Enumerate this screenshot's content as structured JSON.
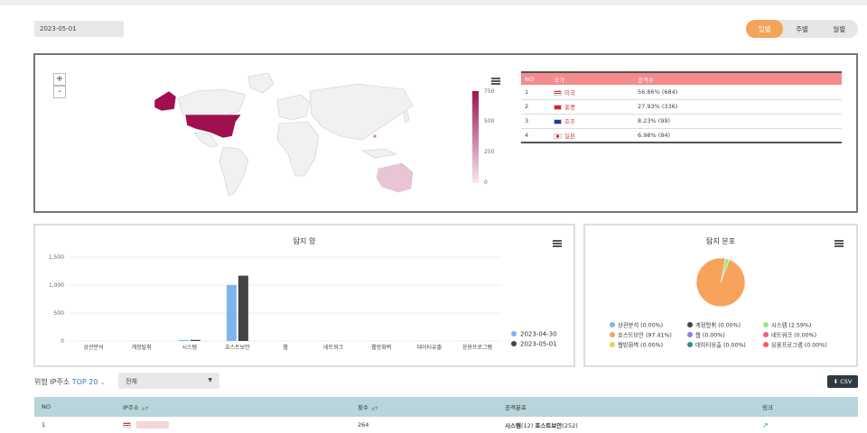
{
  "date": "2023-05-01",
  "period": {
    "tabs": [
      "일별",
      "주별",
      "월별"
    ],
    "active": "일별"
  },
  "map": {
    "zoom_in": "+",
    "zoom_out": "-",
    "scale_ticks": [
      "750",
      "500",
      "250",
      "0"
    ],
    "colors": {
      "max": "#a0104f",
      "min": "#f7e9f1"
    }
  },
  "geo_table": {
    "headers": [
      "NO",
      "국가",
      "공격수"
    ],
    "rows": [
      {
        "no": "1",
        "flag": "us-flag",
        "country": "미국",
        "attacks": "56.86% (684)"
      },
      {
        "no": "2",
        "flag": "hk-flag",
        "country": "홍콩",
        "attacks": "27.93% (336)"
      },
      {
        "no": "3",
        "flag": "au-flag",
        "country": "호주",
        "attacks": "8.23% (99)"
      },
      {
        "no": "4",
        "flag": "jp-flag",
        "country": "일본",
        "attacks": "6.98% (84)"
      }
    ]
  },
  "bar_panel": {
    "title": "탐지 양"
  },
  "pie_panel": {
    "title": "탐지 분포"
  },
  "chart_data": [
    {
      "type": "bar",
      "title": "탐지 양",
      "categories": [
        "상관분석",
        "계정탈취",
        "시스템",
        "호스트보안",
        "웹",
        "네트워크",
        "웹방화벽",
        "데이터유출",
        "응용프로그램"
      ],
      "series": [
        {
          "name": "2023-04-30",
          "color": "#7cb5ec",
          "values": [
            0,
            0,
            12,
            1000,
            0,
            0,
            0,
            0,
            0
          ]
        },
        {
          "name": "2023-05-01",
          "color": "#434348",
          "values": [
            0,
            0,
            12,
            1168,
            0,
            0,
            0,
            0,
            0
          ]
        }
      ],
      "yticks": [
        "0",
        "500",
        "1,000",
        "1,500"
      ],
      "ylim": [
        0,
        1500
      ],
      "grid": true,
      "legend": "right"
    },
    {
      "type": "pie",
      "title": "탐지 분포",
      "slices": [
        {
          "label": "상관분석 (0.00%)",
          "value": 0.0,
          "color": "#7cb5ec"
        },
        {
          "label": "계정탈취 (0.00%)",
          "value": 0.0,
          "color": "#434348"
        },
        {
          "label": "시스템 (2.59%)",
          "value": 2.59,
          "color": "#90ed7d"
        },
        {
          "label": "호스트보안 (97.41%)",
          "value": 97.41,
          "color": "#f7a35c"
        },
        {
          "label": "웹 (0.00%)",
          "value": 0.0,
          "color": "#8085e9"
        },
        {
          "label": "네트워크 (0.00%)",
          "value": 0.0,
          "color": "#f15c80"
        },
        {
          "label": "웹방화벽 (0.00%)",
          "value": 0.0,
          "color": "#e4d354"
        },
        {
          "label": "데이터유출 (0.00%)",
          "value": 0.0,
          "color": "#2b908f"
        },
        {
          "label": "응용프로그램 (0.00%)",
          "value": 0.0,
          "color": "#f45b5b"
        }
      ],
      "legend": "bottom"
    }
  ],
  "filter": {
    "label_prefix": "위험 IP주소",
    "label_top": "TOP",
    "top_value": "20",
    "select_value": "전체",
    "csv_label": "CSV"
  },
  "ip_table": {
    "headers": [
      "NO",
      "IP주소",
      "횟수",
      "공격분포",
      "링크"
    ],
    "rows": [
      {
        "no": "1",
        "flag": "us-flag",
        "count": "264",
        "dist_a": "시스템",
        "dist_a_count": "(12)",
        "dist_b": "호스트보안",
        "dist_b_count": "(252)"
      }
    ]
  }
}
